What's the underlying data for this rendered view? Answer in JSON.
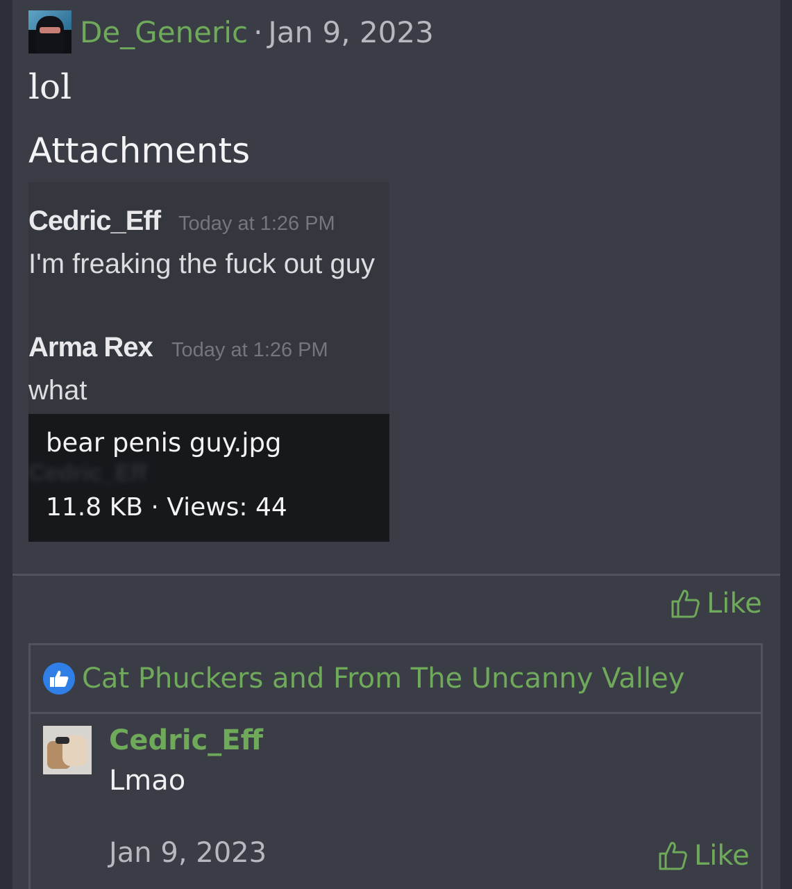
{
  "post": {
    "author": "De_Generic",
    "separator": "·",
    "date": "Jan 9, 2023",
    "body": "lol"
  },
  "attachments": {
    "title": "Attachments",
    "preview": {
      "msg1_user": "Cedric_Eff",
      "msg1_time": "Today at 1:26 PM",
      "msg1_text": "I'm freaking the fuck out guy",
      "msg2_user": "Arma Rex",
      "msg2_time": "Today at 1:26 PM",
      "msg2_text": "what"
    },
    "file": {
      "name": "bear penis guy.jpg",
      "meta": "11.8 KB · Views: 44"
    }
  },
  "actions": {
    "like_label": "Like"
  },
  "reactions": {
    "icon": "thumbs-up-icon",
    "names": "Cat Phuckers and From The Uncanny Valley"
  },
  "reply": {
    "author": "Cedric_Eff",
    "text": "Lmao",
    "date": "Jan 9, 2023",
    "like_label": "Like"
  },
  "colors": {
    "accent": "#6fa95a",
    "background": "#2c2f37",
    "card": "#3a3d46",
    "reaction_badge": "#2f7fe6"
  }
}
